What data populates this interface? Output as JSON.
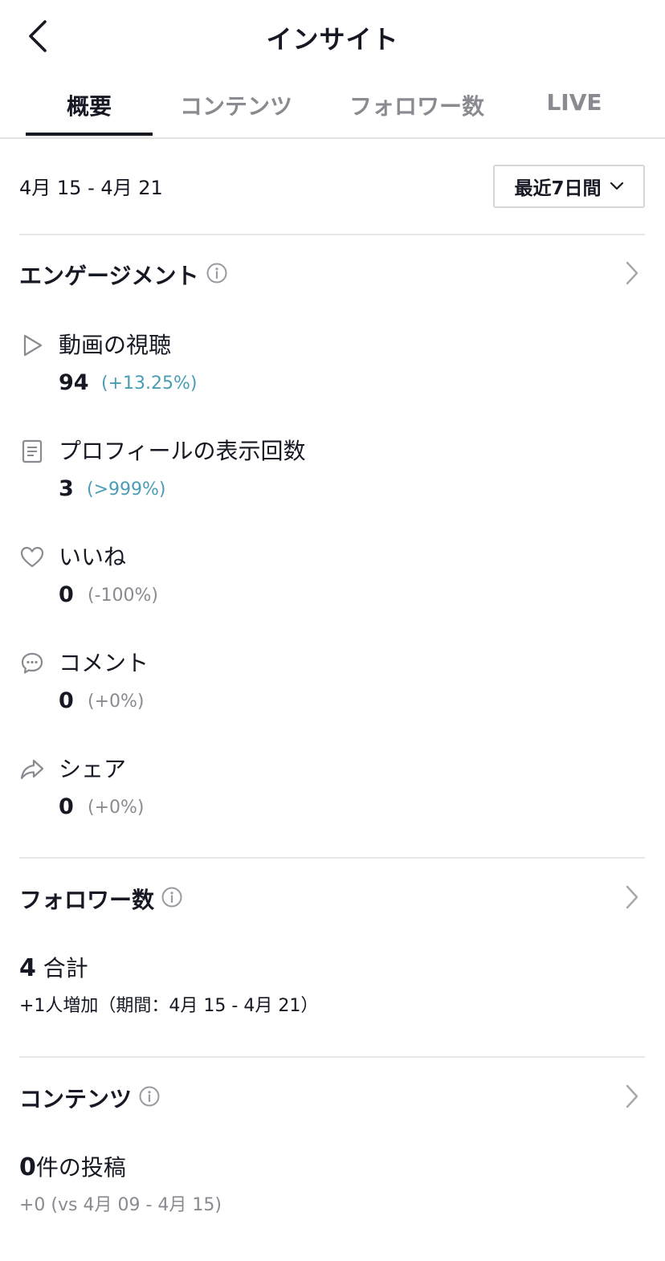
{
  "header": {
    "title": "インサイト"
  },
  "tabs": [
    {
      "label": "概要"
    },
    {
      "label": "コンテンツ"
    },
    {
      "label": "フォロワー数"
    },
    {
      "label": "LIVE"
    }
  ],
  "active_tab": "概要",
  "date_range": "4月 15 - 4月 21",
  "period_select": {
    "label": "最近7日間"
  },
  "engagement": {
    "title": "エンゲージメント",
    "metrics": [
      {
        "label": "動画の視聴",
        "value": "94",
        "change": "(+13.25%)"
      },
      {
        "label": "プロフィールの表示回数",
        "value": "3",
        "change": "(>999%)"
      },
      {
        "label": "いいね",
        "value": "0",
        "change": "(-100%)"
      },
      {
        "label": "コメント",
        "value": "0",
        "change": "(+0%)"
      },
      {
        "label": "シェア",
        "value": "0",
        "change": "(+0%)"
      }
    ]
  },
  "followers": {
    "title": "フォロワー数",
    "total_value": "4",
    "total_label": "合計",
    "delta_text": "+1人増加（期間：4月 15 - 4月 21）"
  },
  "content": {
    "title": "コンテンツ",
    "posts_value": "0",
    "posts_label": "件の投稿",
    "compare_text": "+0 (vs 4月 09 - 4月 15)"
  },
  "colors": {
    "text": "#161823",
    "muted": "#8a8b91",
    "positive_change": "#4a9db5",
    "divider": "#e6e6e7"
  }
}
